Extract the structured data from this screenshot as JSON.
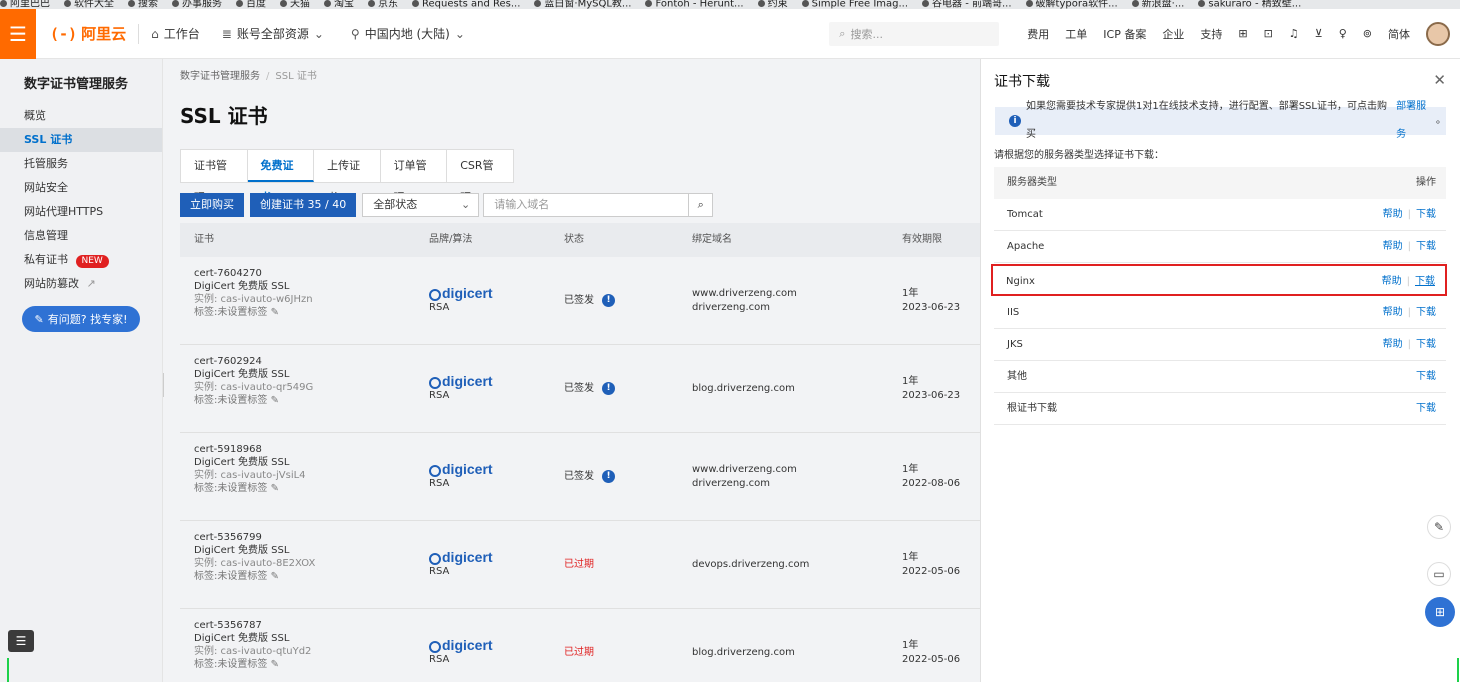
{
  "bookmarks": [
    "阿里巴巴",
    "软件大全",
    "搜索",
    "办事服务",
    "百度",
    "天猫",
    "淘宝",
    "京东",
    "Requests and Res...",
    "蓝白窗·MySQL教...",
    "Fontoh - Herunt...",
    "约束",
    "Simple Free Imag...",
    "谷电器 - 前端哥...",
    "破解typora软件...",
    "新浪盘·...",
    "sakuraro - 精致壁..."
  ],
  "topbar": {
    "logo_text": "阿里云",
    "logo_mark": "(-)",
    "workbench": "工作台",
    "account": "账号全部资源",
    "region": "中国内地 (大陆)",
    "search_placeholder": "搜索...",
    "right_links": [
      "费用",
      "工单",
      "ICP 备案",
      "企业",
      "支持"
    ],
    "lang": "简体"
  },
  "sidebar": {
    "title": "数字证书管理服务",
    "items": [
      {
        "label": "概览"
      },
      {
        "label": "SSL 证书"
      },
      {
        "label": "托管服务"
      },
      {
        "label": "网站安全"
      },
      {
        "label": "网站代理HTTPS"
      },
      {
        "label": "信息管理"
      },
      {
        "label": "私有证书"
      },
      {
        "label": "网站防篡改"
      }
    ],
    "new_badge": "NEW",
    "help_button": "有问题? 找专家!"
  },
  "main": {
    "breadcrumb": [
      "数字证书管理服务",
      "SSL 证书"
    ],
    "page_title": "SSL 证书",
    "tabs": [
      "证书管理",
      "免费证书",
      "上传证书",
      "订单管理",
      "CSR管理"
    ],
    "buy_button": "立即购买",
    "create_button": "创建证书 35 / 40",
    "status_select": "全部状态",
    "domain_placeholder": "请输入域名",
    "columns": [
      "证书",
      "品牌/算法",
      "状态",
      "绑定域名",
      "有效期限"
    ],
    "rows": [
      {
        "id": "cert-7604270",
        "product": "DigiCert 免费版 SSL",
        "instance": "实例: cas-ivauto-w6JHzn",
        "tag": "标签:未设置标签",
        "brand": "digicert",
        "algo": "RSA",
        "status": "已签发",
        "status_type": "ok",
        "domain1": "www.driverzeng.com",
        "domain2": "driverzeng.com",
        "period": "1年",
        "date": "2023-06-23"
      },
      {
        "id": "cert-7602924",
        "product": "DigiCert 免费版 SSL",
        "instance": "实例: cas-ivauto-qr549G",
        "tag": "标签:未设置标签",
        "brand": "digicert",
        "algo": "RSA",
        "status": "已签发",
        "status_type": "ok",
        "domain1": "blog.driverzeng.com",
        "domain2": "",
        "period": "1年",
        "date": "2023-06-23"
      },
      {
        "id": "cert-5918968",
        "product": "DigiCert 免费版 SSL",
        "instance": "实例: cas-ivauto-jVsiL4",
        "tag": "标签:未设置标签",
        "brand": "digicert",
        "algo": "RSA",
        "status": "已签发",
        "status_type": "ok",
        "domain1": "www.driverzeng.com",
        "domain2": "driverzeng.com",
        "period": "1年",
        "date": "2022-08-06"
      },
      {
        "id": "cert-5356799",
        "product": "DigiCert 免费版 SSL",
        "instance": "实例: cas-ivauto-8E2XOX",
        "tag": "标签:未设置标签",
        "brand": "digicert",
        "algo": "RSA",
        "status": "已过期",
        "status_type": "bad",
        "domain1": "devops.driverzeng.com",
        "domain2": "",
        "period": "1年",
        "date": "2022-05-06"
      },
      {
        "id": "cert-5356787",
        "product": "DigiCert 免费版 SSL",
        "instance": "实例: cas-ivauto-qtuYd2",
        "tag": "标签:未设置标签",
        "brand": "digicert",
        "algo": "RSA",
        "status": "已过期",
        "status_type": "bad",
        "domain1": "blog.driverzeng.com",
        "domain2": "",
        "period": "1年",
        "date": "2022-05-06"
      }
    ]
  },
  "drawer": {
    "title": "证书下载",
    "info_text": "如果您需要技术专家提供1对1在线技术支持，进行配置、部署SSL证书，可点击购买",
    "info_link": "部署服务",
    "info_tail": "。",
    "hint": "请根据您的服务器类型选择证书下载：",
    "col_type": "服务器类型",
    "col_action": "操作",
    "help_label": "帮助",
    "download_label": "下载",
    "servers": [
      {
        "name": "Tomcat",
        "has_help": true,
        "highlight": false
      },
      {
        "name": "Apache",
        "has_help": true,
        "highlight": false
      },
      {
        "name": "Nginx",
        "has_help": true,
        "highlight": true
      },
      {
        "name": "IIS",
        "has_help": true,
        "highlight": false
      },
      {
        "name": "JKS",
        "has_help": true,
        "highlight": false
      },
      {
        "name": "其他",
        "has_help": false,
        "highlight": false
      },
      {
        "name": "根证书下载",
        "has_help": false,
        "highlight": false
      }
    ]
  },
  "colors": {
    "brand_orange": "#ff6a00",
    "primary_blue": "#1f5fb8",
    "link_blue": "#0070cc",
    "danger_red": "#e02020",
    "new_badge_red": "#e02020"
  }
}
